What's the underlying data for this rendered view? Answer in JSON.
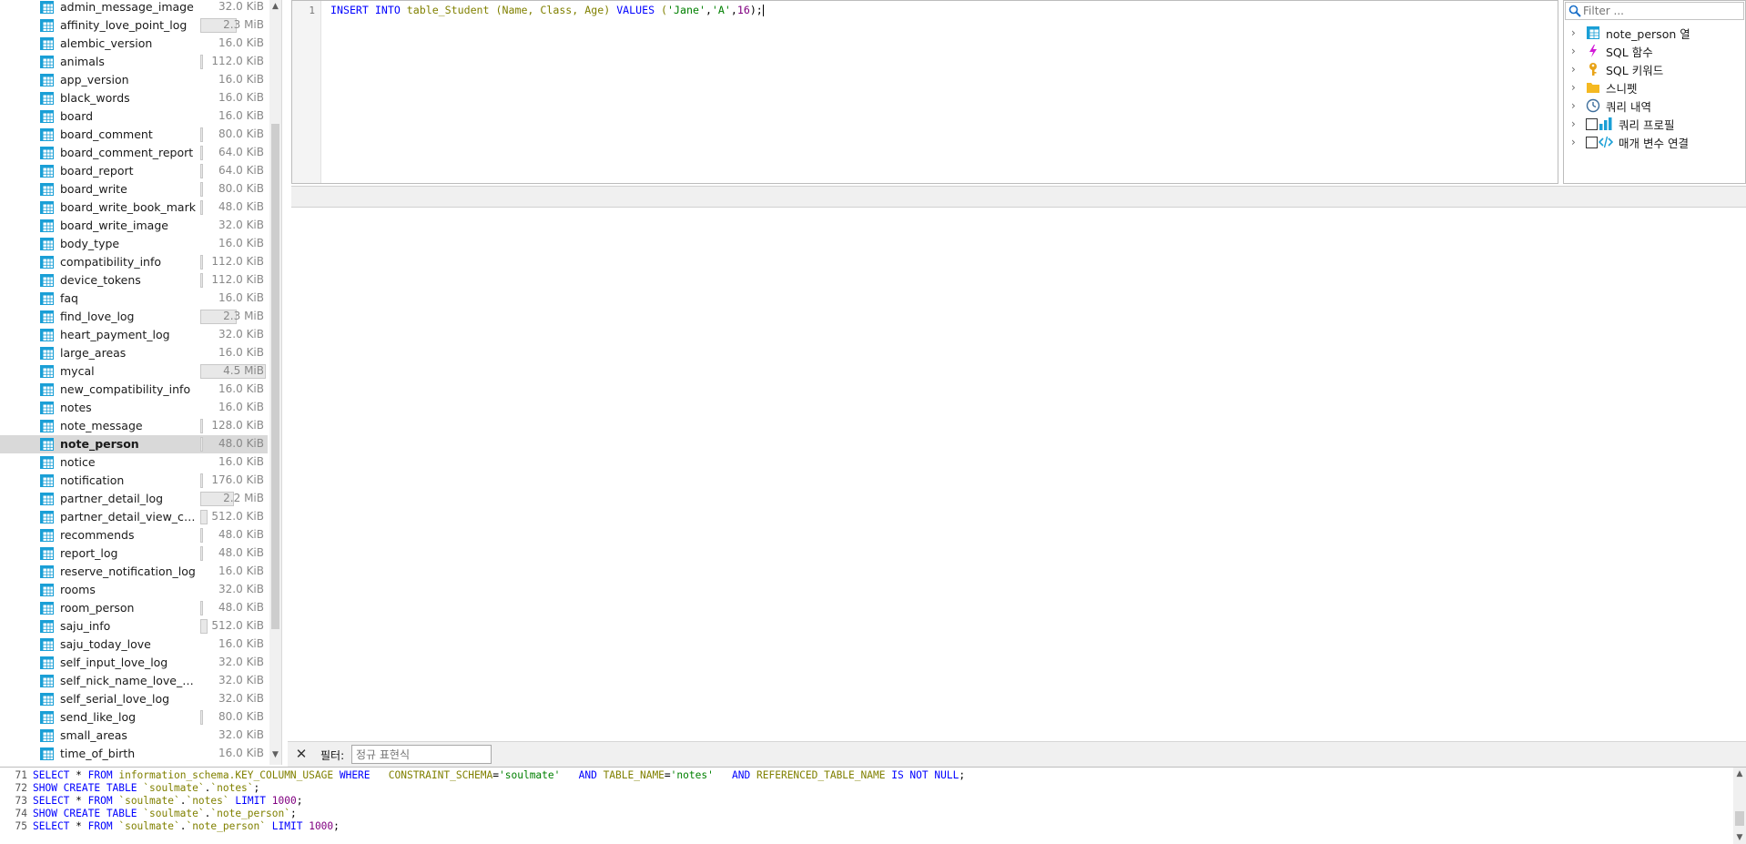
{
  "sidebar": {
    "tables": [
      {
        "name": "admin_message_image",
        "size": "32.0 KiB",
        "bar": 0
      },
      {
        "name": "affinity_love_point_log",
        "size": "2.3 MiB",
        "bar": 0.55
      },
      {
        "name": "alembic_version",
        "size": "16.0 KiB",
        "bar": 0
      },
      {
        "name": "animals",
        "size": "112.0 KiB",
        "bar": 0.03
      },
      {
        "name": "app_version",
        "size": "16.0 KiB",
        "bar": 0
      },
      {
        "name": "black_words",
        "size": "16.0 KiB",
        "bar": 0
      },
      {
        "name": "board",
        "size": "16.0 KiB",
        "bar": 0
      },
      {
        "name": "board_comment",
        "size": "80.0 KiB",
        "bar": 0.02
      },
      {
        "name": "board_comment_report",
        "size": "64.0 KiB",
        "bar": 0.02
      },
      {
        "name": "board_report",
        "size": "64.0 KiB",
        "bar": 0.02
      },
      {
        "name": "board_write",
        "size": "80.0 KiB",
        "bar": 0.02
      },
      {
        "name": "board_write_book_mark",
        "size": "48.0 KiB",
        "bar": 0.01
      },
      {
        "name": "board_write_image",
        "size": "32.0 KiB",
        "bar": 0
      },
      {
        "name": "body_type",
        "size": "16.0 KiB",
        "bar": 0
      },
      {
        "name": "compatibility_info",
        "size": "112.0 KiB",
        "bar": 0.03
      },
      {
        "name": "device_tokens",
        "size": "112.0 KiB",
        "bar": 0.03
      },
      {
        "name": "faq",
        "size": "16.0 KiB",
        "bar": 0
      },
      {
        "name": "find_love_log",
        "size": "2.3 MiB",
        "bar": 0.55
      },
      {
        "name": "heart_payment_log",
        "size": "32.0 KiB",
        "bar": 0
      },
      {
        "name": "large_areas",
        "size": "16.0 KiB",
        "bar": 0
      },
      {
        "name": "mycal",
        "size": "4.5 MiB",
        "bar": 1.0
      },
      {
        "name": "new_compatibility_info",
        "size": "16.0 KiB",
        "bar": 0
      },
      {
        "name": "notes",
        "size": "16.0 KiB",
        "bar": 0
      },
      {
        "name": "note_message",
        "size": "128.0 KiB",
        "bar": 0.03
      },
      {
        "name": "note_person",
        "size": "48.0 KiB",
        "bar": 0.01,
        "selected": true
      },
      {
        "name": "notice",
        "size": "16.0 KiB",
        "bar": 0
      },
      {
        "name": "notification",
        "size": "176.0 KiB",
        "bar": 0.04
      },
      {
        "name": "partner_detail_log",
        "size": "2.2 MiB",
        "bar": 0.52
      },
      {
        "name": "partner_detail_view_count...",
        "size": "512.0 KiB",
        "bar": 0.11
      },
      {
        "name": "recommends",
        "size": "48.0 KiB",
        "bar": 0.01
      },
      {
        "name": "report_log",
        "size": "48.0 KiB",
        "bar": 0.01
      },
      {
        "name": "reserve_notification_log",
        "size": "16.0 KiB",
        "bar": 0
      },
      {
        "name": "rooms",
        "size": "32.0 KiB",
        "bar": 0
      },
      {
        "name": "room_person",
        "size": "48.0 KiB",
        "bar": 0.01
      },
      {
        "name": "saju_info",
        "size": "512.0 KiB",
        "bar": 0.11
      },
      {
        "name": "saju_today_love",
        "size": "16.0 KiB",
        "bar": 0
      },
      {
        "name": "self_input_love_log",
        "size": "32.0 KiB",
        "bar": 0
      },
      {
        "name": "self_nick_name_love_log",
        "size": "32.0 KiB",
        "bar": 0
      },
      {
        "name": "self_serial_love_log",
        "size": "32.0 KiB",
        "bar": 0
      },
      {
        "name": "send_like_log",
        "size": "80.0 KiB",
        "bar": 0.02
      },
      {
        "name": "small_areas",
        "size": "32.0 KiB",
        "bar": 0
      },
      {
        "name": "time_of_birth",
        "size": "16.0 KiB",
        "bar": 0
      }
    ]
  },
  "editor": {
    "line_number": "1",
    "tokens": {
      "insert": "INSERT",
      "into": "INTO",
      "table": "table_Student",
      "open_paren": " (",
      "col1": "Name",
      "comma1": ", ",
      "col2": "Class",
      "comma2": ", ",
      "col3": "Age",
      "close_paren": ") ",
      "values": "VALUES",
      "open_paren2": " (",
      "val1": "'Jane'",
      "comma3": ",",
      "val2": "'A'",
      "comma4": ",",
      "val3": "16",
      "close": ");"
    }
  },
  "helper": {
    "filter_placeholder": "Filter ...",
    "items": [
      {
        "label": "note_person 열",
        "icon": "table-icon",
        "checkbox": false
      },
      {
        "label": "SQL 함수",
        "icon": "lightning-icon",
        "checkbox": false
      },
      {
        "label": "SQL 키워드",
        "icon": "key-icon",
        "checkbox": false
      },
      {
        "label": "스니펫",
        "icon": "folder-icon",
        "checkbox": false
      },
      {
        "label": "쿼리 내역",
        "icon": "clock-icon",
        "checkbox": false
      },
      {
        "label": "쿼리 프로필",
        "icon": "bar-chart-icon",
        "checkbox": true
      },
      {
        "label": "매개 변수 연결",
        "icon": "code-icon",
        "checkbox": true
      }
    ]
  },
  "filter_bar": {
    "close": "✕",
    "label": "필터:",
    "placeholder": "정규 표현식"
  },
  "log": {
    "lines": [
      {
        "no": "71",
        "parts": [
          {
            "t": "kw",
            "v": "SELECT"
          },
          {
            "t": "p",
            "v": " * "
          },
          {
            "t": "kw",
            "v": "FROM"
          },
          {
            "t": "p",
            "v": " "
          },
          {
            "t": "id",
            "v": "information_schema.KEY_COLUMN_USAGE"
          },
          {
            "t": "p",
            "v": " "
          },
          {
            "t": "kw",
            "v": "WHERE"
          },
          {
            "t": "p",
            "v": "   "
          },
          {
            "t": "id",
            "v": "CONSTRAINT_SCHEMA"
          },
          {
            "t": "p",
            "v": "="
          },
          {
            "t": "str",
            "v": "'soulmate'"
          },
          {
            "t": "p",
            "v": "   "
          },
          {
            "t": "kw",
            "v": "AND"
          },
          {
            "t": "p",
            "v": " "
          },
          {
            "t": "id",
            "v": "TABLE_NAME"
          },
          {
            "t": "p",
            "v": "="
          },
          {
            "t": "str",
            "v": "'notes'"
          },
          {
            "t": "p",
            "v": "   "
          },
          {
            "t": "kw",
            "v": "AND"
          },
          {
            "t": "p",
            "v": " "
          },
          {
            "t": "id",
            "v": "REFERENCED_TABLE_NAME"
          },
          {
            "t": "p",
            "v": " "
          },
          {
            "t": "kw",
            "v": "IS NOT NULL"
          },
          {
            "t": "p",
            "v": ";"
          }
        ]
      },
      {
        "no": "72",
        "parts": [
          {
            "t": "kw",
            "v": "SHOW CREATE TABLE"
          },
          {
            "t": "p",
            "v": " "
          },
          {
            "t": "id",
            "v": "`soulmate`"
          },
          {
            "t": "p",
            "v": "."
          },
          {
            "t": "id",
            "v": "`notes`"
          },
          {
            "t": "p",
            "v": ";"
          }
        ]
      },
      {
        "no": "73",
        "parts": [
          {
            "t": "kw",
            "v": "SELECT"
          },
          {
            "t": "p",
            "v": " * "
          },
          {
            "t": "kw",
            "v": "FROM"
          },
          {
            "t": "p",
            "v": " "
          },
          {
            "t": "id",
            "v": "`soulmate`"
          },
          {
            "t": "p",
            "v": "."
          },
          {
            "t": "id",
            "v": "`notes`"
          },
          {
            "t": "p",
            "v": " "
          },
          {
            "t": "kw",
            "v": "LIMIT"
          },
          {
            "t": "p",
            "v": " "
          },
          {
            "t": "num",
            "v": "1000"
          },
          {
            "t": "p",
            "v": ";"
          }
        ]
      },
      {
        "no": "74",
        "parts": [
          {
            "t": "kw",
            "v": "SHOW CREATE TABLE"
          },
          {
            "t": "p",
            "v": " "
          },
          {
            "t": "id",
            "v": "`soulmate`"
          },
          {
            "t": "p",
            "v": "."
          },
          {
            "t": "id",
            "v": "`note_person`"
          },
          {
            "t": "p",
            "v": ";"
          }
        ]
      },
      {
        "no": "75",
        "parts": [
          {
            "t": "kw",
            "v": "SELECT"
          },
          {
            "t": "p",
            "v": " * "
          },
          {
            "t": "kw",
            "v": "FROM"
          },
          {
            "t": "p",
            "v": " "
          },
          {
            "t": "id",
            "v": "`soulmate`"
          },
          {
            "t": "p",
            "v": "."
          },
          {
            "t": "id",
            "v": "`note_person`"
          },
          {
            "t": "p",
            "v": " "
          },
          {
            "t": "kw",
            "v": "LIMIT"
          },
          {
            "t": "p",
            "v": " "
          },
          {
            "t": "num",
            "v": "1000"
          },
          {
            "t": "p",
            "v": ";"
          }
        ]
      }
    ]
  },
  "colors": {
    "keyword": "#0000ff",
    "identifier": "#808000",
    "string": "#008000",
    "number": "#800080",
    "selection": "#d9d9d9",
    "table_icon": "#1a9fd6"
  }
}
